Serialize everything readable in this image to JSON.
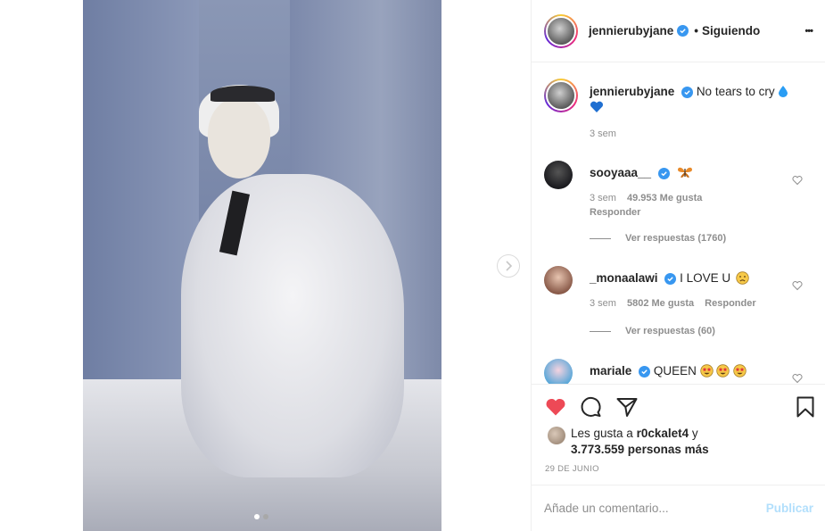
{
  "post": {
    "username": "jennierubyjane",
    "following_separator": "•",
    "following_label": "Siguiendo",
    "more_label": "•••",
    "media_alt": "photo",
    "carousel": {
      "count": 2,
      "active_index": 0
    }
  },
  "caption": {
    "username": "jennierubyjane",
    "text": "No tears to cry",
    "emojis": [
      "droplet",
      "blue-heart"
    ],
    "time": "3 sem"
  },
  "comments": [
    {
      "username": "sooyaaa__",
      "text": "",
      "emojis": [
        "butterfly"
      ],
      "time": "3 sem",
      "likes": "49.953 Me gusta",
      "reply_label": "Responder",
      "view_replies": "Ver respuestas (1760)",
      "avatar_color": "#1b1b1f"
    },
    {
      "username": "_monaalawi",
      "text": "I LOVE U",
      "emojis": [
        "sad-face"
      ],
      "time": "3 sem",
      "likes": "5802 Me gusta",
      "reply_label": "Responder",
      "view_replies": "Ver respuestas (60)",
      "avatar_color": "#b78d7a"
    },
    {
      "username": "mariale",
      "text": "QUEEN",
      "emojis": [
        "star-eyes",
        "star-eyes",
        "star-eyes"
      ],
      "time": "",
      "likes": "",
      "reply_label": "",
      "view_replies": "",
      "avatar_color": "#5aa7d8"
    }
  ],
  "likes": {
    "prefix": "Les gusta a",
    "user": "r0ckalet4",
    "connector": "y",
    "count": "3.773.559 personas más"
  },
  "date": "29 DE JUNIO",
  "add_comment": {
    "placeholder": "Añade un comentario...",
    "publish_label": "Publicar"
  },
  "colors": {
    "accent": "#3897f0",
    "like_red": "#ed4956",
    "publish_disabled": "#b2dffc",
    "muted": "#8e8e8e"
  }
}
